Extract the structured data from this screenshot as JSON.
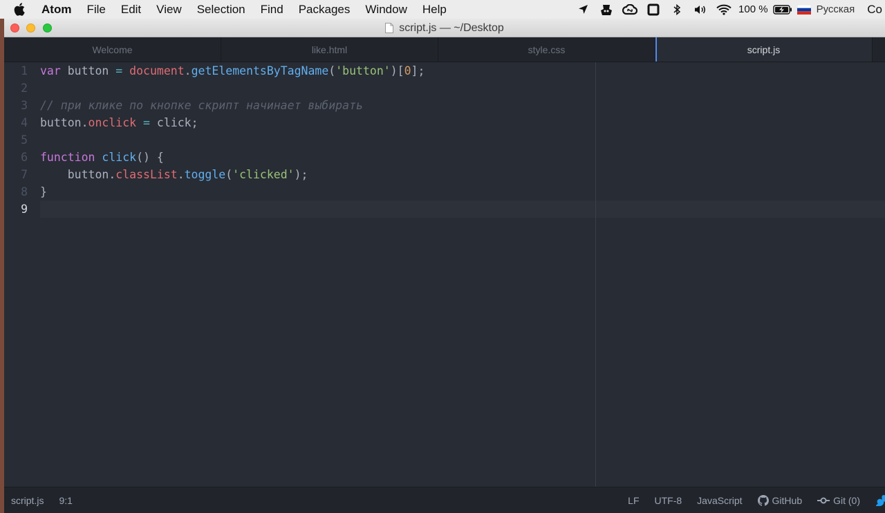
{
  "menubar": {
    "app": "Atom",
    "items": [
      "File",
      "Edit",
      "View",
      "Selection",
      "Find",
      "Packages",
      "Window",
      "Help"
    ],
    "battery": "100 %",
    "input_source": "Русская",
    "clipped": "Co"
  },
  "window": {
    "title": "script.js — ~/Desktop"
  },
  "tabs": [
    {
      "label": "Welcome",
      "active": false
    },
    {
      "label": "like.html",
      "active": false
    },
    {
      "label": "style.css",
      "active": false
    },
    {
      "label": "script.js",
      "active": true
    }
  ],
  "editor": {
    "line_numbers": [
      "1",
      "2",
      "3",
      "4",
      "5",
      "6",
      "7",
      "8",
      "9"
    ],
    "current_line": 9,
    "lines": [
      [
        [
          "kw",
          "var"
        ],
        [
          "pl",
          " button "
        ],
        [
          "op",
          "="
        ],
        [
          "pl",
          " "
        ],
        [
          "var2",
          "document"
        ],
        [
          "pl",
          "."
        ],
        [
          "fn",
          "getElementsByTagName"
        ],
        [
          "pl",
          "("
        ],
        [
          "str",
          "'button'"
        ],
        [
          "pl",
          ")["
        ],
        [
          "num",
          "0"
        ],
        [
          "pl",
          "];"
        ]
      ],
      [],
      [
        [
          "cm",
          "// при клике по кнопке скрипт начинает выбирать"
        ]
      ],
      [
        [
          "pl",
          "button."
        ],
        [
          "var2",
          "onclick"
        ],
        [
          "pl",
          " "
        ],
        [
          "op",
          "="
        ],
        [
          "pl",
          " click;"
        ]
      ],
      [],
      [
        [
          "kw",
          "function"
        ],
        [
          "pl",
          " "
        ],
        [
          "fn",
          "click"
        ],
        [
          "pl",
          "() {"
        ]
      ],
      [
        [
          "pl",
          "    button."
        ],
        [
          "var2",
          "classList"
        ],
        [
          "pl",
          "."
        ],
        [
          "fn",
          "toggle"
        ],
        [
          "pl",
          "("
        ],
        [
          "str",
          "'clicked'"
        ],
        [
          "pl",
          ");"
        ]
      ],
      [
        [
          "pl",
          "}"
        ]
      ],
      []
    ]
  },
  "statusbar": {
    "file": "script.js",
    "cursor": "9:1",
    "line_ending": "LF",
    "encoding": "UTF-8",
    "grammar": "JavaScript",
    "github": "GitHub",
    "git": "Git (0)"
  },
  "colors": {
    "editor_bg": "#282c34",
    "keyword": "#c678dd",
    "function": "#61afef",
    "property": "#e06c75",
    "string": "#98c379",
    "number": "#d19a66",
    "operator": "#56b6c2",
    "comment": "#5c6370",
    "accent": "#568af2"
  }
}
